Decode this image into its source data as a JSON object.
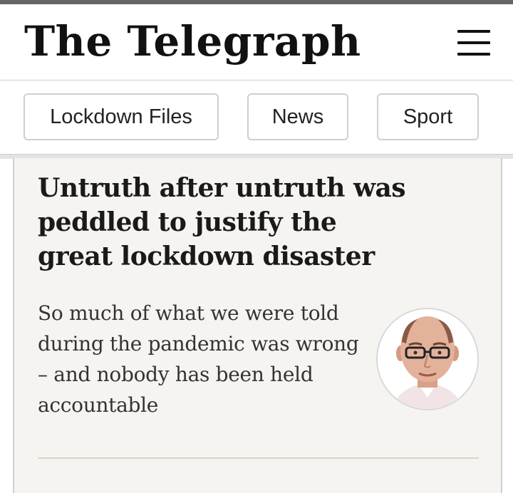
{
  "header": {
    "logo_text": "The Telegraph",
    "menu_icon": "hamburger-menu-icon"
  },
  "nav": {
    "items": [
      {
        "label": "Lockdown Files"
      },
      {
        "label": "News"
      },
      {
        "label": "Sport"
      }
    ]
  },
  "article": {
    "headline": "Untruth after untruth was peddled to justify the great lockdown disaster",
    "standfirst": "So much of what we were told during the pandemic was wrong – and nobody has been held accountable",
    "author_avatar": "author-portrait"
  },
  "colors": {
    "card_background": "#f6f4f0",
    "headline_text": "#1a1a1a",
    "body_text": "#333333"
  }
}
